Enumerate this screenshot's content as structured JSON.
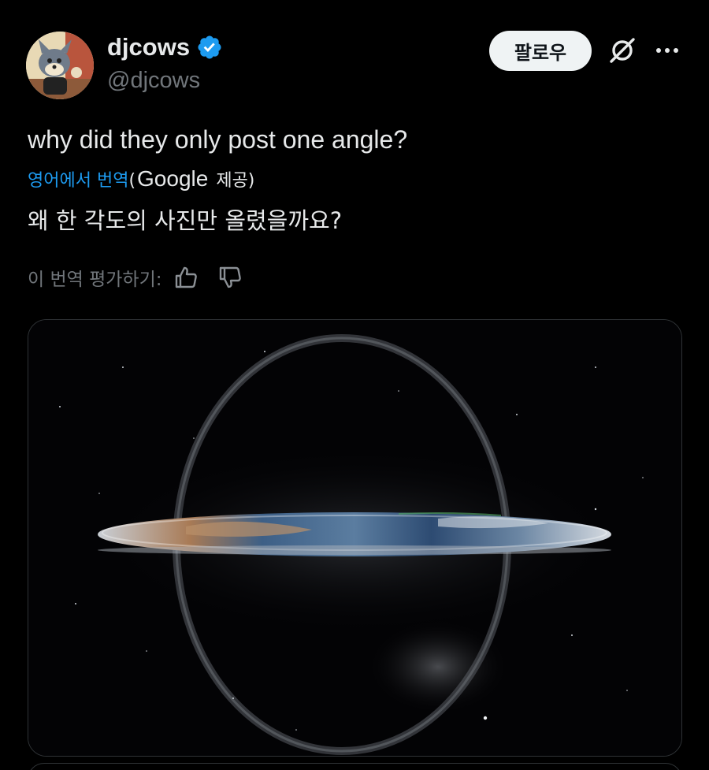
{
  "author": {
    "display_name": "djcows",
    "handle": "@djcows",
    "verified": true,
    "verified_color": "#1d9bf0"
  },
  "actions": {
    "follow_label": "팔로우",
    "grok_icon": "grok-icon",
    "more_icon": "more-horizontal-icon"
  },
  "tweet": {
    "text": "why did they only post one angle?",
    "translate_label": "영어에서 번역",
    "translate_open_paren": "(",
    "translate_provider": "Google",
    "translate_provided": "제공)",
    "translated_text": "왜 한 각도의 사진만 올렸을까요?"
  },
  "rating": {
    "label": "이 번역 평가하기:",
    "thumbs_up_icon": "thumbs-up-icon",
    "thumbs_down_icon": "thumbs-down-icon"
  },
  "media": {
    "alt": "flat-earth-disc-in-space-image"
  },
  "colors": {
    "background": "#000000",
    "text_primary": "#e7e9ea",
    "text_secondary": "#71767b",
    "link": "#1d9bf0",
    "button_bg": "#eff3f4"
  }
}
